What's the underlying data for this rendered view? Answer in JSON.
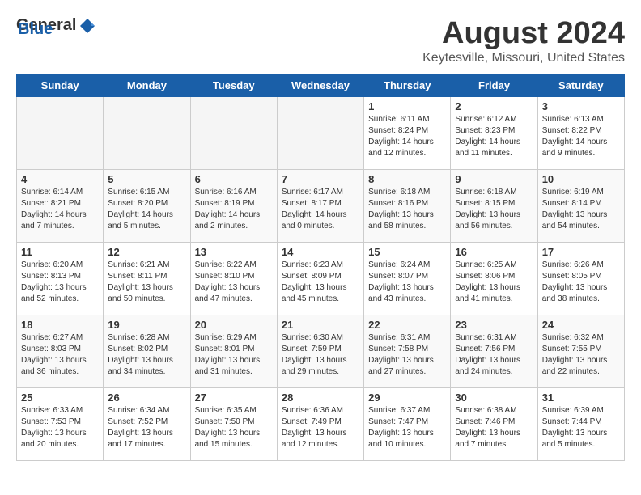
{
  "header": {
    "logo_general": "General",
    "logo_blue": "Blue",
    "month_title": "August 2024",
    "location": "Keytesville, Missouri, United States"
  },
  "days_of_week": [
    "Sunday",
    "Monday",
    "Tuesday",
    "Wednesday",
    "Thursday",
    "Friday",
    "Saturday"
  ],
  "weeks": [
    [
      {
        "day": "",
        "info": ""
      },
      {
        "day": "",
        "info": ""
      },
      {
        "day": "",
        "info": ""
      },
      {
        "day": "",
        "info": ""
      },
      {
        "day": "1",
        "info": "Sunrise: 6:11 AM\nSunset: 8:24 PM\nDaylight: 14 hours\nand 12 minutes."
      },
      {
        "day": "2",
        "info": "Sunrise: 6:12 AM\nSunset: 8:23 PM\nDaylight: 14 hours\nand 11 minutes."
      },
      {
        "day": "3",
        "info": "Sunrise: 6:13 AM\nSunset: 8:22 PM\nDaylight: 14 hours\nand 9 minutes."
      }
    ],
    [
      {
        "day": "4",
        "info": "Sunrise: 6:14 AM\nSunset: 8:21 PM\nDaylight: 14 hours\nand 7 minutes."
      },
      {
        "day": "5",
        "info": "Sunrise: 6:15 AM\nSunset: 8:20 PM\nDaylight: 14 hours\nand 5 minutes."
      },
      {
        "day": "6",
        "info": "Sunrise: 6:16 AM\nSunset: 8:19 PM\nDaylight: 14 hours\nand 2 minutes."
      },
      {
        "day": "7",
        "info": "Sunrise: 6:17 AM\nSunset: 8:17 PM\nDaylight: 14 hours\nand 0 minutes."
      },
      {
        "day": "8",
        "info": "Sunrise: 6:18 AM\nSunset: 8:16 PM\nDaylight: 13 hours\nand 58 minutes."
      },
      {
        "day": "9",
        "info": "Sunrise: 6:18 AM\nSunset: 8:15 PM\nDaylight: 13 hours\nand 56 minutes."
      },
      {
        "day": "10",
        "info": "Sunrise: 6:19 AM\nSunset: 8:14 PM\nDaylight: 13 hours\nand 54 minutes."
      }
    ],
    [
      {
        "day": "11",
        "info": "Sunrise: 6:20 AM\nSunset: 8:13 PM\nDaylight: 13 hours\nand 52 minutes."
      },
      {
        "day": "12",
        "info": "Sunrise: 6:21 AM\nSunset: 8:11 PM\nDaylight: 13 hours\nand 50 minutes."
      },
      {
        "day": "13",
        "info": "Sunrise: 6:22 AM\nSunset: 8:10 PM\nDaylight: 13 hours\nand 47 minutes."
      },
      {
        "day": "14",
        "info": "Sunrise: 6:23 AM\nSunset: 8:09 PM\nDaylight: 13 hours\nand 45 minutes."
      },
      {
        "day": "15",
        "info": "Sunrise: 6:24 AM\nSunset: 8:07 PM\nDaylight: 13 hours\nand 43 minutes."
      },
      {
        "day": "16",
        "info": "Sunrise: 6:25 AM\nSunset: 8:06 PM\nDaylight: 13 hours\nand 41 minutes."
      },
      {
        "day": "17",
        "info": "Sunrise: 6:26 AM\nSunset: 8:05 PM\nDaylight: 13 hours\nand 38 minutes."
      }
    ],
    [
      {
        "day": "18",
        "info": "Sunrise: 6:27 AM\nSunset: 8:03 PM\nDaylight: 13 hours\nand 36 minutes."
      },
      {
        "day": "19",
        "info": "Sunrise: 6:28 AM\nSunset: 8:02 PM\nDaylight: 13 hours\nand 34 minutes."
      },
      {
        "day": "20",
        "info": "Sunrise: 6:29 AM\nSunset: 8:01 PM\nDaylight: 13 hours\nand 31 minutes."
      },
      {
        "day": "21",
        "info": "Sunrise: 6:30 AM\nSunset: 7:59 PM\nDaylight: 13 hours\nand 29 minutes."
      },
      {
        "day": "22",
        "info": "Sunrise: 6:31 AM\nSunset: 7:58 PM\nDaylight: 13 hours\nand 27 minutes."
      },
      {
        "day": "23",
        "info": "Sunrise: 6:31 AM\nSunset: 7:56 PM\nDaylight: 13 hours\nand 24 minutes."
      },
      {
        "day": "24",
        "info": "Sunrise: 6:32 AM\nSunset: 7:55 PM\nDaylight: 13 hours\nand 22 minutes."
      }
    ],
    [
      {
        "day": "25",
        "info": "Sunrise: 6:33 AM\nSunset: 7:53 PM\nDaylight: 13 hours\nand 20 minutes."
      },
      {
        "day": "26",
        "info": "Sunrise: 6:34 AM\nSunset: 7:52 PM\nDaylight: 13 hours\nand 17 minutes."
      },
      {
        "day": "27",
        "info": "Sunrise: 6:35 AM\nSunset: 7:50 PM\nDaylight: 13 hours\nand 15 minutes."
      },
      {
        "day": "28",
        "info": "Sunrise: 6:36 AM\nSunset: 7:49 PM\nDaylight: 13 hours\nand 12 minutes."
      },
      {
        "day": "29",
        "info": "Sunrise: 6:37 AM\nSunset: 7:47 PM\nDaylight: 13 hours\nand 10 minutes."
      },
      {
        "day": "30",
        "info": "Sunrise: 6:38 AM\nSunset: 7:46 PM\nDaylight: 13 hours\nand 7 minutes."
      },
      {
        "day": "31",
        "info": "Sunrise: 6:39 AM\nSunset: 7:44 PM\nDaylight: 13 hours\nand 5 minutes."
      }
    ]
  ]
}
